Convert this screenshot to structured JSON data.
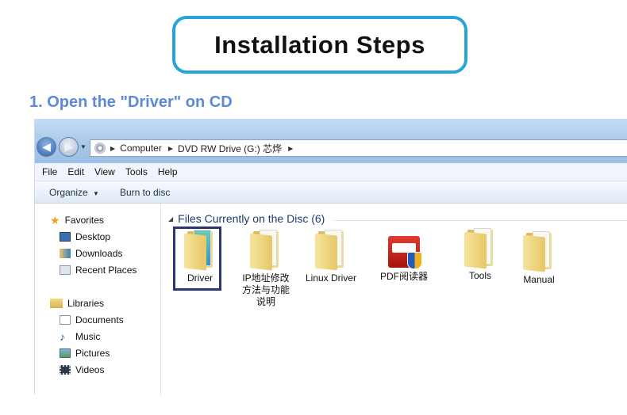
{
  "banner": {
    "title": "Installation Steps"
  },
  "step": {
    "text": "1. Open the \"Driver\" on CD"
  },
  "explorer": {
    "breadcrumb": [
      "Computer",
      "DVD RW Drive (G:) 芯烨"
    ],
    "menu": [
      "File",
      "Edit",
      "View",
      "Tools",
      "Help"
    ],
    "toolbar": {
      "organize": "Organize",
      "burn": "Burn to disc"
    },
    "sidebar": {
      "favorites": "Favorites",
      "desktop": "Desktop",
      "downloads": "Downloads",
      "recent": "Recent Places",
      "libraries": "Libraries",
      "documents": "Documents",
      "music": "Music",
      "pictures": "Pictures",
      "videos": "Videos"
    },
    "group_header": "Files Currently on the Disc (6)",
    "files": [
      "Driver",
      "IP地址修改方法与功能说明",
      "Linux Driver",
      "PDF阅读器",
      "Tools",
      "Manual"
    ]
  },
  "colors": {
    "step_text": "#5b8ad6",
    "title_border": "#29a3dc",
    "selection_border": "#2b3676"
  }
}
